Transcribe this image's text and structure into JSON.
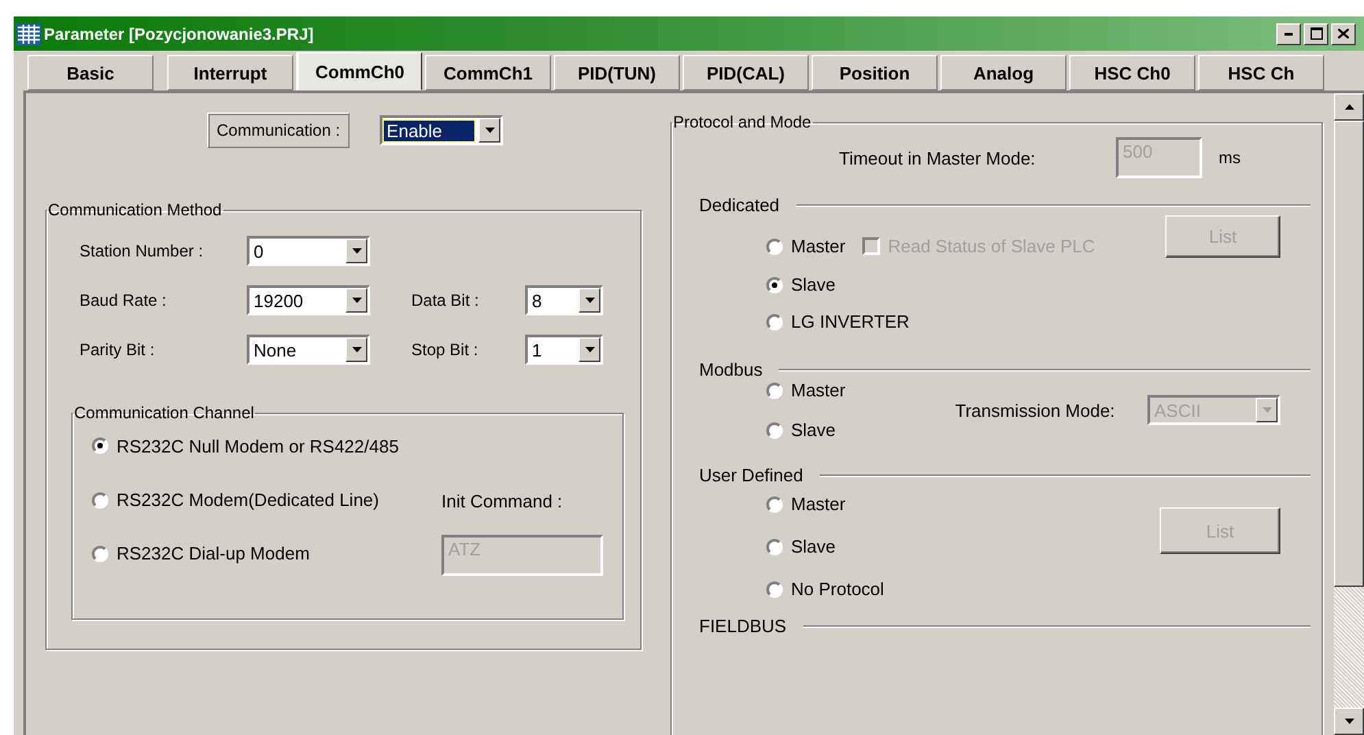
{
  "window": {
    "title": "Parameter [Pozycjonowanie3.PRJ]"
  },
  "tabs": [
    {
      "label": "Basic",
      "selected": false
    },
    {
      "label": "Interrupt",
      "selected": false
    },
    {
      "label": "CommCh0",
      "selected": true
    },
    {
      "label": "CommCh1",
      "selected": false
    },
    {
      "label": "PID(TUN)",
      "selected": false
    },
    {
      "label": "PID(CAL)",
      "selected": false
    },
    {
      "label": "Position",
      "selected": false
    },
    {
      "label": "Analog",
      "selected": false
    },
    {
      "label": "HSC Ch0",
      "selected": false
    },
    {
      "label": "HSC Ch",
      "selected": false
    }
  ],
  "communication": {
    "label": "Communication :",
    "value": "Enable"
  },
  "method": {
    "title": "Communication Method",
    "rows": [
      [
        {
          "label": "Station Number :",
          "value": "0"
        }
      ],
      [
        {
          "label": "Baud Rate :",
          "value": "19200"
        },
        {
          "label": "Data Bit :",
          "value": "8"
        }
      ],
      [
        {
          "label": "Parity Bit :",
          "value": "None"
        },
        {
          "label": "Stop Bit :",
          "value": "1"
        }
      ]
    ]
  },
  "channel": {
    "title": "Communication Channel",
    "options": [
      {
        "label": "RS232C Null Modem or RS422/485",
        "selected": true
      },
      {
        "label": "RS232C Modem(Dedicated Line)",
        "selected": false
      },
      {
        "label": "RS232C Dial-up Modem",
        "selected": false
      }
    ],
    "init_label": "Init Command :",
    "init_value": "ATZ",
    "init_disabled": true
  },
  "protocol": {
    "title": "Protocol and Mode",
    "timeout_label": "Timeout in Master Mode:",
    "timeout_value": "500",
    "timeout_disabled": true,
    "timeout_unit": "ms",
    "sections": [
      {
        "kind": "dedicated",
        "title": "Dedicated",
        "options": [
          {
            "label": "Master",
            "selected": false
          },
          {
            "label": "Slave",
            "selected": true
          },
          {
            "label": "LG INVERTER",
            "selected": false
          }
        ],
        "checkbox": {
          "label": "Read Status of Slave PLC",
          "checked": false,
          "disabled": true
        },
        "button": {
          "label": "List",
          "disabled": true
        }
      },
      {
        "kind": "modbus",
        "title": "Modbus",
        "options": [
          {
            "label": "Master",
            "selected": false
          },
          {
            "label": "Slave",
            "selected": false
          }
        ],
        "mode_label": "Transmission Mode:",
        "mode_value": "ASCII",
        "mode_disabled": true
      },
      {
        "kind": "user",
        "title": "User Defined",
        "options": [
          {
            "label": "Master",
            "selected": false
          },
          {
            "label": "Slave",
            "selected": false
          },
          {
            "label": "No Protocol",
            "selected": false
          }
        ],
        "button": {
          "label": "List",
          "disabled": true
        }
      },
      {
        "kind": "fieldbus",
        "title": "FIELDBUS"
      }
    ]
  }
}
